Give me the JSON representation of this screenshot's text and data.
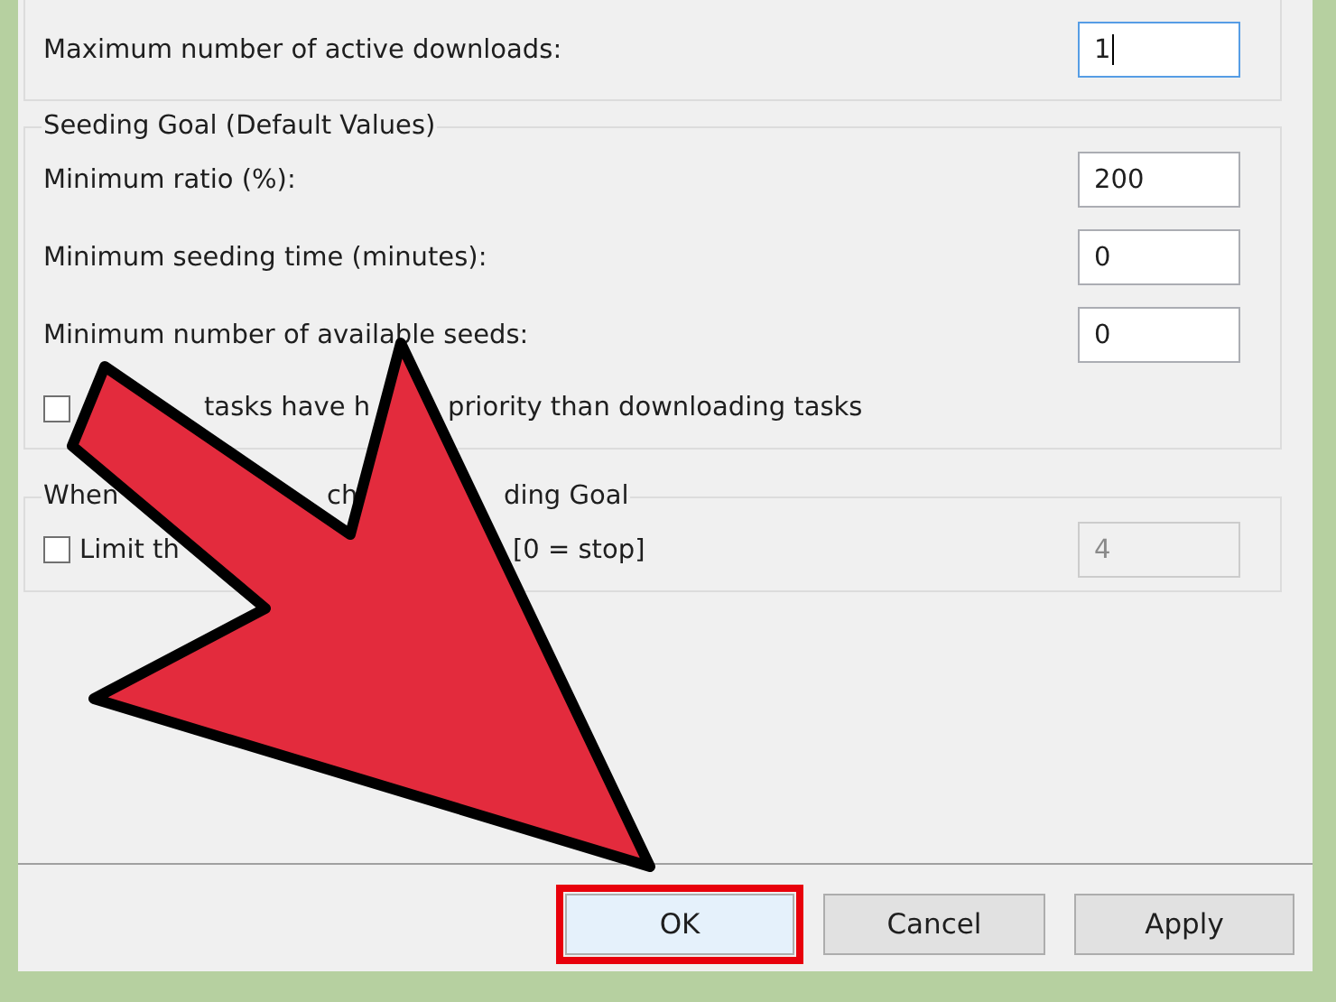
{
  "downloads": {
    "label": "Maximum number of active downloads:",
    "value": "1",
    "focused": true
  },
  "seeding_goal": {
    "title": "Seeding Goal (Default Values)",
    "fields": [
      {
        "label": "Minimum ratio (%):",
        "value": "200"
      },
      {
        "label": "Minimum seeding time (minutes):",
        "value": "0"
      },
      {
        "label": "Minimum number of available seeds:",
        "value": "0"
      }
    ],
    "priority_option": {
      "checked": false,
      "label_fragments": [
        "tasks have h",
        "priority than downloading tasks"
      ]
    }
  },
  "when_reached": {
    "title_fragments": [
      "When",
      "ch",
      "ding Goal"
    ],
    "limit_option": {
      "checked": false,
      "label_fragments": [
        "Limit th",
        "[0 = stop]"
      ],
      "value": "4",
      "disabled": true
    }
  },
  "buttons": [
    {
      "label": "OK",
      "highlighted": true
    },
    {
      "label": "Cancel",
      "highlighted": false
    },
    {
      "label": "Apply",
      "highlighted": false
    }
  ]
}
